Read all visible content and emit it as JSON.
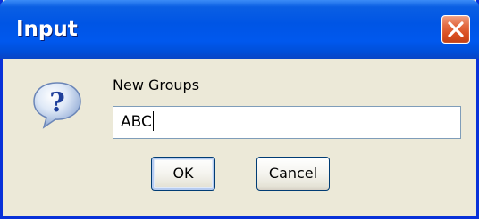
{
  "window": {
    "title": "Input"
  },
  "icons": {
    "dialog_icon": "question-icon",
    "close_icon": "close-icon"
  },
  "dialog": {
    "prompt": "New Groups",
    "input_value": "ABC"
  },
  "buttons": {
    "ok_label": "OK",
    "cancel_label": "Cancel"
  },
  "colors": {
    "titlebar": "#0055e5",
    "close_button": "#d94e20",
    "background": "#ece9d8"
  }
}
